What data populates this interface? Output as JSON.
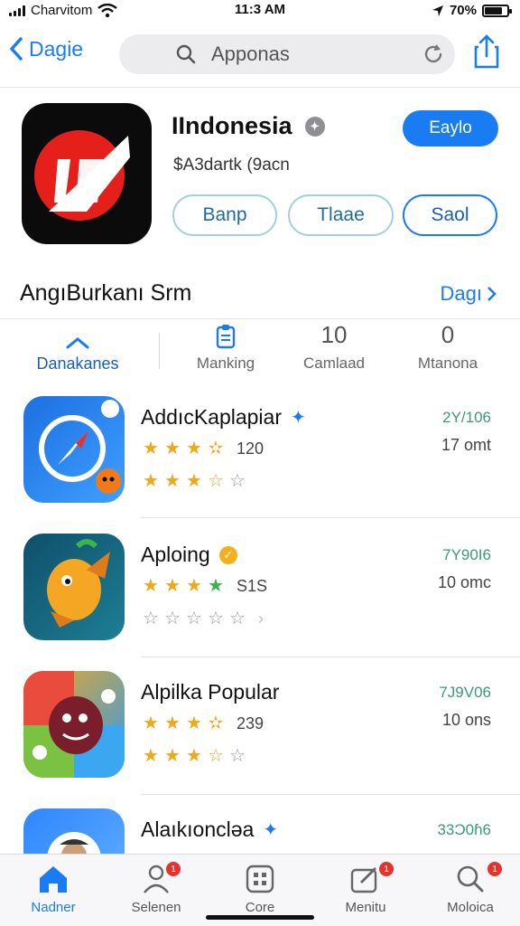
{
  "status_bar": {
    "carrier": "Charvitom",
    "time": "11:3 AM",
    "battery": "70%"
  },
  "nav": {
    "back_label": "Dagie",
    "search_query": "Apponas"
  },
  "hero": {
    "title": "IIndonesia",
    "subtitle": "$A3dartk (9acn",
    "get_label": "Eaylo",
    "pills": [
      "Banp",
      "Tlaae",
      "Saol"
    ],
    "icon_color": "#e5201b"
  },
  "section": {
    "title": "AngıBurkanı Srm",
    "link": "Dagı"
  },
  "tabs": [
    {
      "icon": "caret-up-icon",
      "glyph": "",
      "label": "Danakanes"
    },
    {
      "icon": "clipboard-icon",
      "glyph": "",
      "label": "Manking"
    },
    {
      "icon": "count-icon",
      "glyph": "10",
      "label": "Camlaad"
    },
    {
      "icon": "count-icon",
      "glyph": "0",
      "label": "Mtanona"
    }
  ],
  "apps": [
    {
      "name": "AddıcKaplapiar",
      "badge": "blue-star-icon",
      "rating_count": "120",
      "meta_top": "2Y/106",
      "meta_bottom": "17 omt",
      "rating1": 3.5,
      "rating2": 3.5,
      "colors": [
        "#1d6fe0",
        "#3ea0ff"
      ]
    },
    {
      "name": "Aploing",
      "badge": "gold-badge-icon",
      "rating_count": "S1S",
      "meta_top": "7Y90I6",
      "meta_bottom": "10 omc",
      "rating1": 4,
      "rating2": 0,
      "colors": [
        "#0f4f6b",
        "#1d7f94"
      ]
    },
    {
      "name": "Alpilka Popular",
      "badge": "",
      "rating_count": "239",
      "meta_top": "7J9V06",
      "meta_bottom": "10 ons",
      "rating1": 3.5,
      "rating2": 3.5,
      "colors": [
        "#f1a81f",
        "#2d9bf0"
      ]
    },
    {
      "name": "Alaıkıoncləa",
      "badge": "blue-star-icon",
      "rating_count": "",
      "meta_top": "33Ɔ0ɦ6",
      "meta_bottom": "",
      "rating1": 0,
      "rating2": 0,
      "colors": [
        "#2f86ff",
        "#66b2ff"
      ]
    }
  ],
  "tab_bar": [
    {
      "icon": "home-icon",
      "label": "Nadner",
      "badge": ""
    },
    {
      "icon": "person-icon",
      "label": "Selenen",
      "badge": "1"
    },
    {
      "icon": "grid-icon",
      "label": "Core",
      "badge": ""
    },
    {
      "icon": "edit-icon",
      "label": "Menitu",
      "badge": "1"
    },
    {
      "icon": "search-icon",
      "label": "Moloica",
      "badge": "1"
    }
  ],
  "colors": {
    "accent": "#1a7cf2",
    "star": "#f2a81d",
    "star_green": "#37b24d"
  }
}
